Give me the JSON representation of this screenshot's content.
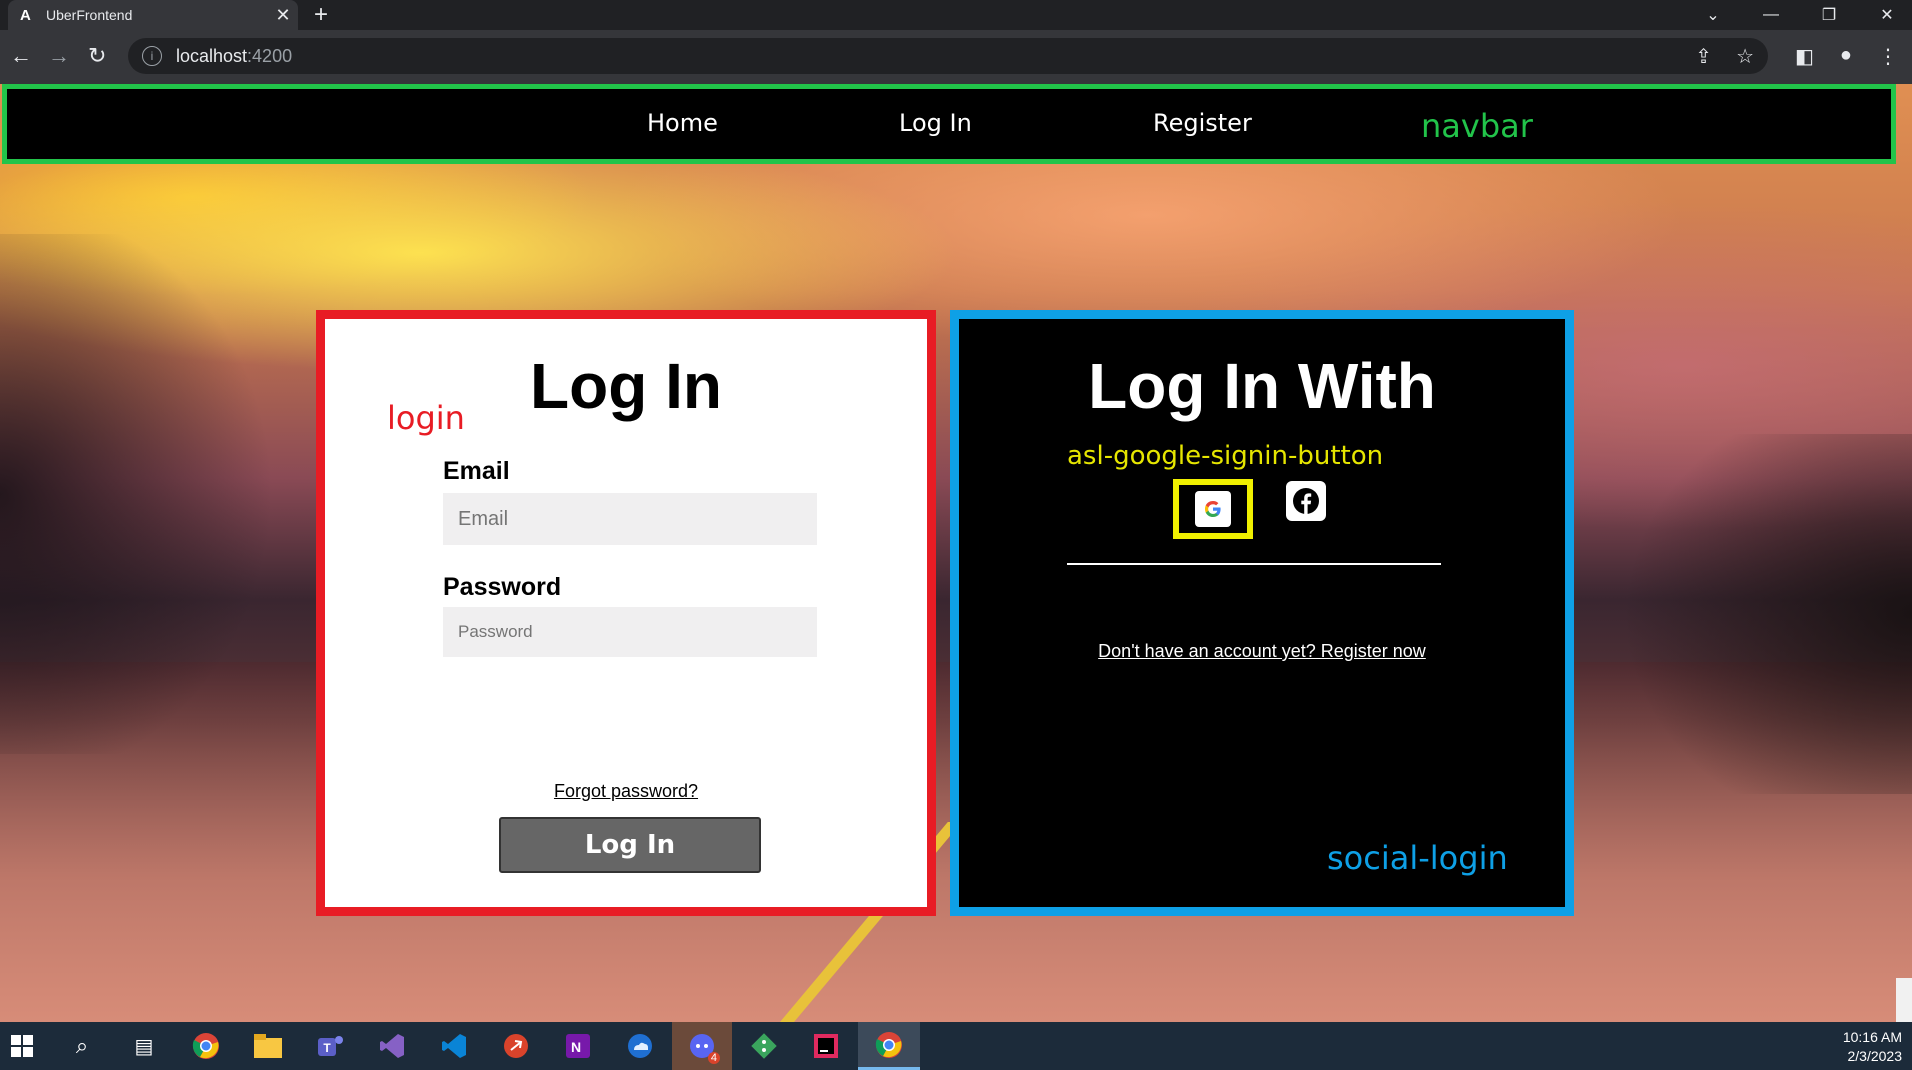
{
  "browser": {
    "tab_title": "UberFrontend",
    "tab_favicon": "A",
    "new_tab": "+",
    "url_host": "localhost",
    "url_port": ":4200"
  },
  "navbar": {
    "links": [
      "Home",
      "Log In",
      "Register"
    ],
    "tag": "navbar"
  },
  "login": {
    "title": "Log In",
    "tag": "login",
    "email_label": "Email",
    "email_placeholder": "Email",
    "password_label": "Password",
    "password_placeholder": "Password",
    "forgot": "Forgot password?",
    "button": "Log In"
  },
  "social": {
    "title": "Log In With",
    "google_tag": "asl-google-signin-button",
    "register_link": "Don't have an account yet? Register now",
    "tag": "social-login"
  },
  "taskbar": {
    "time": "10:16 AM",
    "date": "2/3/2023",
    "app_badge": "4"
  },
  "colors": {
    "navbar_border": "#22c44a",
    "login_border": "#e81c24",
    "social_border": "#0ea0e6",
    "google_highlight": "#f0f000"
  }
}
